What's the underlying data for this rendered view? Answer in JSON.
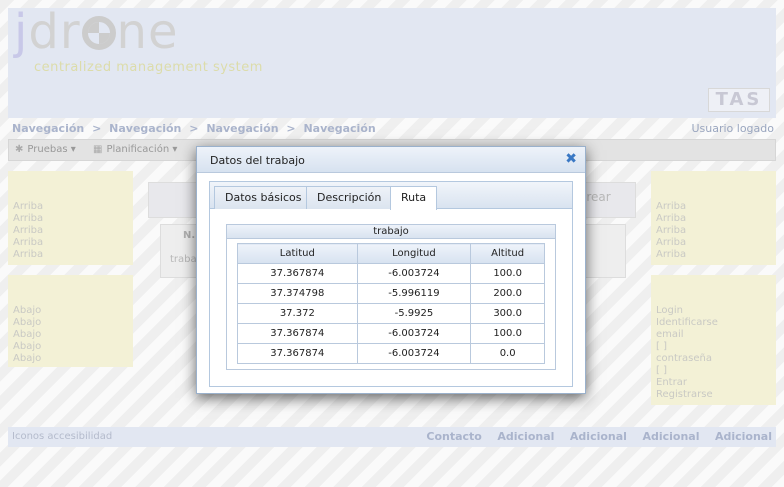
{
  "header": {
    "logo_j": "j",
    "logo_d": "dr",
    "logo_rest": "ne",
    "logo_subtitle": "centralized management system",
    "partner_logo": "TAS"
  },
  "breadcrumb": {
    "items": [
      "Navegación",
      "Navegación",
      "Navegación",
      "Navegación"
    ],
    "separator": ">"
  },
  "user_status": "Usuario logado",
  "menubar": {
    "items": [
      {
        "label": "Pruebas",
        "icon": "gear-icon"
      },
      {
        "label": "Planificación",
        "icon": "calendar-icon"
      }
    ]
  },
  "left_top_box": [
    "Arriba",
    "Arriba",
    "Arriba",
    "Arriba",
    "Arriba"
  ],
  "left_bottom_box": [
    "Abajo",
    "Abajo",
    "Abajo",
    "Abajo",
    "Abajo"
  ],
  "right_top_box": [
    "Arriba",
    "Arriba",
    "Arriba",
    "Arriba",
    "Arriba"
  ],
  "right_bottom_box": [
    "Login",
    "Identificarse",
    "email",
    "[ ]",
    "contraseña",
    "[ ]",
    "Entrar",
    "Registrarse"
  ],
  "background_content": {
    "create_button": "Crear",
    "column_header": "N.",
    "row_text": "traba"
  },
  "footer": {
    "left": "Iconos accesibilidad",
    "links": [
      "Contacto",
      "Adicional",
      "Adicional",
      "Adicional",
      "Adicional"
    ]
  },
  "modal": {
    "title": "Datos del trabajo",
    "tabs": [
      "Datos básicos",
      "Descripción",
      "Ruta"
    ],
    "active_tab": "Ruta",
    "route": {
      "caption": "trabajo",
      "columns": [
        "Latitud",
        "Longitud",
        "Altitud"
      ],
      "rows": [
        [
          "37.367874",
          "-6.003724",
          "100.0"
        ],
        [
          "37.374798",
          "-5.996119",
          "200.0"
        ],
        [
          "37.372",
          "-5.9925",
          "300.0"
        ],
        [
          "37.367874",
          "-6.003724",
          "100.0"
        ],
        [
          "37.367874",
          "-6.003724",
          "0.0"
        ]
      ]
    }
  },
  "colors": {
    "accent": "#3a78c4",
    "header_bg": "#e2e7f2",
    "sidebox_bg": "#f3f1d6"
  }
}
